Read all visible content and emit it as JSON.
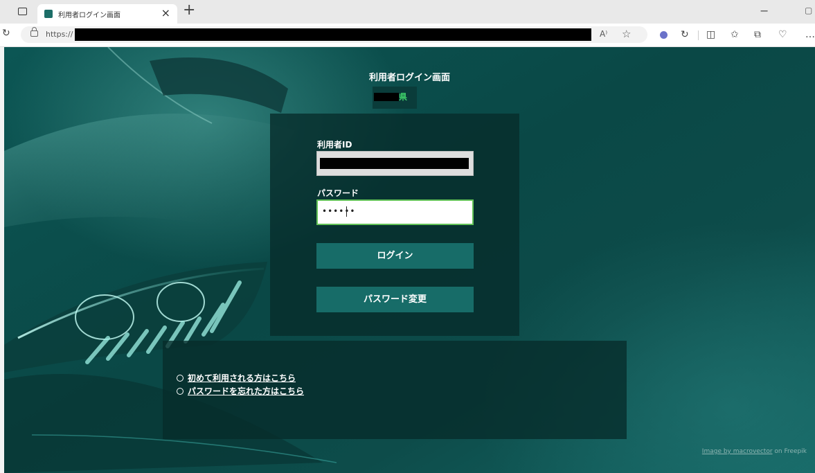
{
  "browser": {
    "tab_title": "利用者ログイン画面",
    "tab_close": "×",
    "new_tab": "+",
    "minimize": "−",
    "restore": "▢",
    "url_prefix": "https://",
    "read_aloud": "A⁾",
    "toolbar_icons": [
      "refresh-icon",
      "tab-actions-icon",
      "lock-icon",
      "read-aloud-icon",
      "favorite-star-icon",
      "extension-icon",
      "refresh-page-icon",
      "split-screen-icon",
      "favorites-icon",
      "collections-icon",
      "browser-essentials-icon",
      "more-icon"
    ]
  },
  "login": {
    "title": "利用者ログイン画面",
    "prefecture_suffix": "県",
    "userid_label": "利用者ID",
    "password_label": "パスワード",
    "password_value": "••••••",
    "login_button": "ログイン",
    "change_password_button": "パスワード変更"
  },
  "links": {
    "first_time": "初めて利用される方はこちら",
    "forgot_password": "パスワードを忘れた方はこちら"
  },
  "credit": {
    "link": "Image by macrovector",
    "suffix": " on Freepik"
  },
  "colors": {
    "background": "#0a4846",
    "panel": "#062c2a",
    "button": "#176c68",
    "prefecture_text": "#3fd06a",
    "password_focus": "#63c257"
  }
}
